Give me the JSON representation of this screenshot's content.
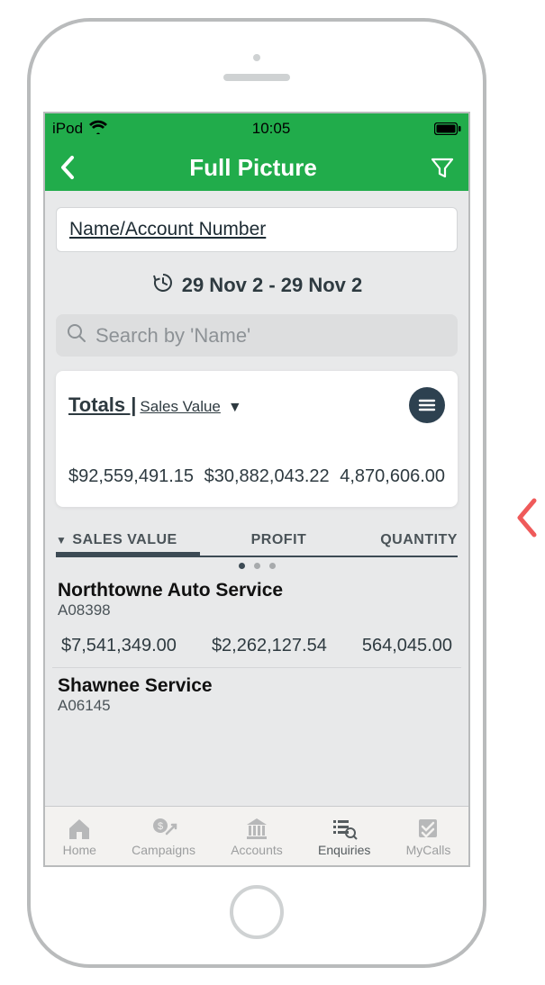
{
  "status": {
    "device": "iPod",
    "time": "10:05"
  },
  "nav": {
    "title": "Full Picture"
  },
  "filters": {
    "name_account_label": "Name/Account Number",
    "date_range": "29 Nov 2 - 29 Nov 2",
    "search_placeholder": "Search by 'Name'"
  },
  "totals": {
    "title": "Totals |",
    "sort_field": " Sales Value",
    "values": {
      "sales_value": "$92,559,491.15",
      "profit": "$30,882,043.22",
      "quantity": "4,870,606.00"
    }
  },
  "columns": {
    "sales_value": "SALES VALUE",
    "profit": "PROFIT",
    "quantity": "QUANTITY"
  },
  "rows": [
    {
      "name": "Northtowne Auto Service",
      "account": "A08398",
      "sales_value": "$7,541,349.00",
      "profit": "$2,262,127.54",
      "quantity": "564,045.00"
    },
    {
      "name": "Shawnee Service",
      "account": "A06145",
      "sales_value": "",
      "profit": "",
      "quantity": ""
    }
  ],
  "tabs": {
    "home": "Home",
    "campaigns": "Campaigns",
    "accounts": "Accounts",
    "enquiries": "Enquiries",
    "mycalls": "MyCalls"
  }
}
